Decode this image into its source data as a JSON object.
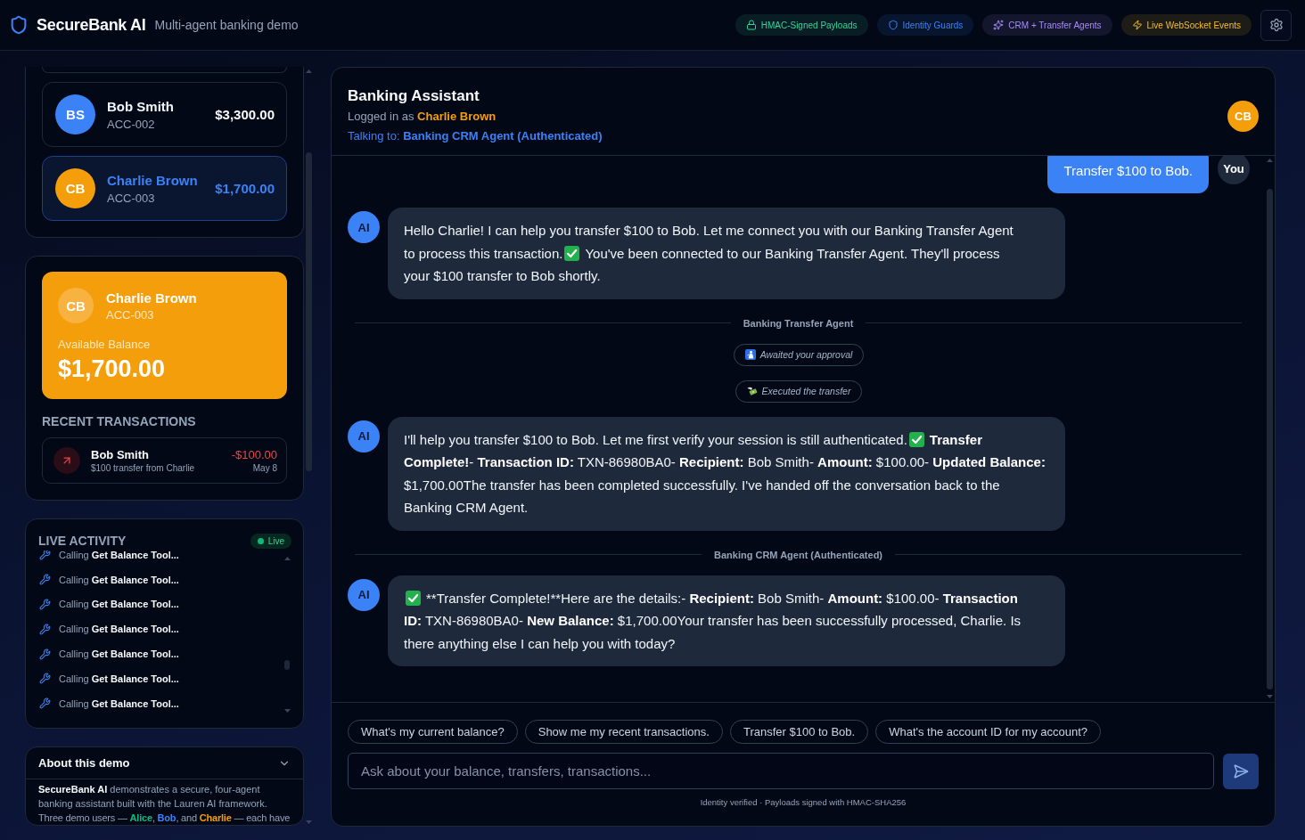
{
  "app": {
    "title": "SecureBank AI",
    "subtitle": "Multi-agent banking demo"
  },
  "feature_badges": [
    {
      "label": "HMAC-Signed Payloads",
      "color": "#34d399"
    },
    {
      "label": "Identity Guards",
      "color": "#3b82f6"
    },
    {
      "label": "CRM + Transfer Agents",
      "color": "#a78bfa"
    },
    {
      "label": "Live WebSocket Events",
      "color": "#fbbf24"
    }
  ],
  "accounts": [
    {
      "initials": "BS",
      "name": "Bob Smith",
      "account_id": "ACC-002",
      "balance": "$3,300.00",
      "color": "#3b82f6",
      "selected": false
    },
    {
      "initials": "CB",
      "name": "Charlie Brown",
      "account_id": "ACC-003",
      "balance": "$1,700.00",
      "color": "#f59e0b",
      "selected": true
    }
  ],
  "balance_card": {
    "initials": "CB",
    "name": "Charlie Brown",
    "account_id": "ACC-003",
    "label": "Available Balance",
    "amount": "$1,700.00"
  },
  "transactions": {
    "heading": "RECENT TRANSACTIONS",
    "items": [
      {
        "kind": "debit",
        "name": "Bob Smith",
        "description": "$100 transfer from Charlie",
        "amount": "-$100.00",
        "date": "May 8"
      }
    ]
  },
  "activity": {
    "heading": "LIVE ACTIVITY",
    "status": "Live",
    "items": [
      "Calling **Get Balance Tool...**",
      "Calling **Get Balance Tool...**",
      "Calling **Get Balance Tool...**",
      "Calling **Get Balance Tool...**",
      "Calling **Get Balance Tool...**",
      "Calling **Get Balance Tool...**",
      "Calling **Get Balance Tool...**"
    ]
  },
  "about": {
    "title": "About this demo",
    "expanded": true,
    "intro": "**SecureBank AI** demonstrates a secure, four-agent banking assistant built with the Lauren AI framework.",
    "users_line": [
      {
        "text": "Three demo users — "
      },
      {
        "text": "Alice",
        "color": "#10b981"
      },
      {
        "text": ", "
      },
      {
        "text": "Bob",
        "color": "#3b82f6"
      },
      {
        "text": ", and "
      },
      {
        "text": "Charlie",
        "color": "#f59e0b"
      },
      {
        "text": " — each have"
      }
    ]
  },
  "chat": {
    "title": "Banking Assistant",
    "logged_in_label": "Logged in as",
    "user_name": "Charlie Brown",
    "user_initials": "CB",
    "talking_label": "Talking to:",
    "agent_name": "Banking CRM Agent (Authenticated)",
    "messages": [
      {
        "kind": "user",
        "avatar": "You",
        "text": "Transfer $100 to Bob."
      },
      {
        "kind": "assistant",
        "avatar": "AI",
        "lines": [
          [
            {
              "kind": "text",
              "parts": [
                {
                  "text": "Hello Charlie! I can help you transfer $100 to Bob. Let me connect you with our Banking Transfer Agent",
                  "bold": false
                }
              ]
            }
          ],
          [
            {
              "kind": "text",
              "parts": [
                {
                  "text": "to process this transaction.",
                  "bold": false
                }
              ]
            },
            {
              "kind": "check"
            },
            {
              "kind": "text",
              "parts": [
                {
                  "text": "You've been connected to our Banking Transfer Agent. They'll process",
                  "bold": false
                }
              ]
            }
          ],
          [
            {
              "kind": "text",
              "parts": [
                {
                  "text": "your $100 transfer to Bob shortly.",
                  "bold": false
                }
              ]
            }
          ]
        ]
      },
      {
        "kind": "handoff",
        "label": "Banking Transfer Agent"
      },
      {
        "kind": "approval",
        "text": "Awaited your approval"
      },
      {
        "kind": "execution",
        "text": "Executed the transfer"
      },
      {
        "kind": "assistant",
        "avatar": "AI",
        "lines": [
          [
            {
              "kind": "text",
              "parts": [
                {
                  "text": "I'll help you transfer $100 to Bob. Let me first verify your session is still authenticated.",
                  "bold": false
                }
              ]
            },
            {
              "kind": "check"
            },
            {
              "kind": "text",
              "parts": [
                {
                  "text": "Transfer",
                  "bold": true
                }
              ]
            }
          ],
          [
            {
              "kind": "text",
              "parts": [
                {
                  "text": "Complete!",
                  "bold": true
                },
                {
                  "text": "- ",
                  "bold": false
                },
                {
                  "text": "Transaction ID:",
                  "bold": true
                },
                {
                  "text": " TXN-86980BA0- ",
                  "bold": false
                },
                {
                  "text": "Recipient:",
                  "bold": true
                },
                {
                  "text": " Bob Smith- ",
                  "bold": false
                },
                {
                  "text": "Amount:",
                  "bold": true
                },
                {
                  "text": " $100.00- ",
                  "bold": false
                },
                {
                  "text": "Updated Balance:",
                  "bold": true
                }
              ]
            }
          ],
          [
            {
              "kind": "text",
              "parts": [
                {
                  "text": "$1,700.00The transfer has been completed successfully. I've handed off the conversation back to the",
                  "bold": false
                }
              ]
            }
          ],
          [
            {
              "kind": "text",
              "parts": [
                {
                  "text": "Banking CRM Agent.",
                  "bold": false
                }
              ]
            }
          ]
        ]
      },
      {
        "kind": "handoff",
        "label": "Banking CRM Agent (Authenticated)"
      },
      {
        "kind": "assistant",
        "avatar": "AI",
        "lines": [
          [
            {
              "kind": "check"
            },
            {
              "kind": "text",
              "parts": [
                {
                  "text": "**Transfer Complete!**Here are the details:- ",
                  "bold": false
                },
                {
                  "text": "Recipient:",
                  "bold": true
                },
                {
                  "text": " Bob Smith- ",
                  "bold": false
                },
                {
                  "text": "Amount:",
                  "bold": true
                },
                {
                  "text": " $100.00- ",
                  "bold": false
                },
                {
                  "text": "Transaction",
                  "bold": true
                }
              ]
            }
          ],
          [
            {
              "kind": "text",
              "parts": [
                {
                  "text": "ID:",
                  "bold": true
                },
                {
                  "text": " TXN-86980BA0- ",
                  "bold": false
                },
                {
                  "text": "New Balance:",
                  "bold": true
                },
                {
                  "text": " $1,700.00Your transfer has been successfully processed, Charlie. Is",
                  "bold": false
                }
              ]
            }
          ],
          [
            {
              "kind": "text",
              "parts": [
                {
                  "text": "there anything else I can help you with today?",
                  "bold": false
                }
              ]
            }
          ]
        ]
      }
    ]
  },
  "composer": {
    "suggestions": [
      "What's my current balance?",
      "Show me my recent transactions.",
      "Transfer $100 to Bob.",
      "What's the account ID for my account?"
    ],
    "placeholder": "Ask about your balance, transfers, transactions...",
    "send_disabled": true,
    "note": "Identity verified · Payloads signed with HMAC-SHA256"
  }
}
